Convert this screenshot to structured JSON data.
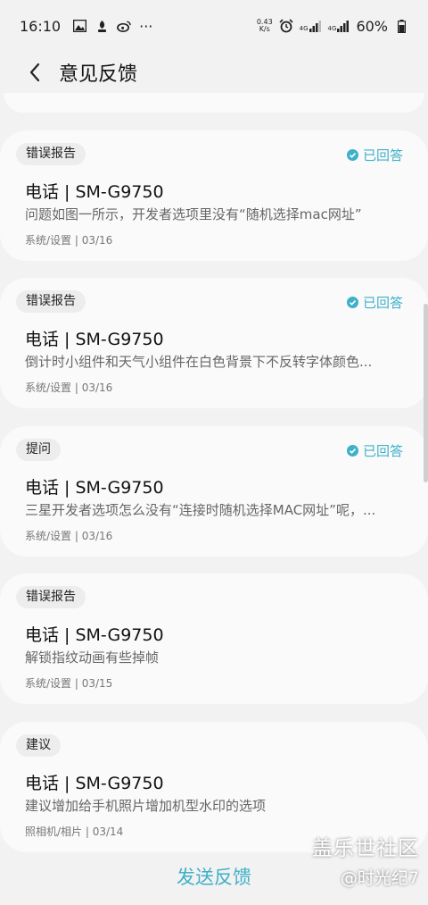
{
  "status_bar": {
    "time": "16:10",
    "more": "···",
    "net_speed_value": "0.43",
    "net_speed_unit": "K/s",
    "signal_label_1": "4G",
    "signal_label_2": "4G",
    "battery": "60%"
  },
  "header": {
    "title": "意见反馈"
  },
  "cards": [
    {
      "tag": "错误报告",
      "status": "已回答",
      "title": "电话 | SM-G9750",
      "desc": "问题如图一所示，开发者选项里没有“随机选择mac网址”",
      "meta": "系统/设置 | 03/16"
    },
    {
      "tag": "错误报告",
      "status": "已回答",
      "title": "电话 | SM-G9750",
      "desc": "倒计时小组件和天气小组件在白色背景下不反转字体颜色...",
      "meta": "系统/设置 | 03/16"
    },
    {
      "tag": "提问",
      "status": "已回答",
      "title": "电话 | SM-G9750",
      "desc": "三星开发者选项怎么没有“连接时随机选择MAC网址”呢，...",
      "meta": "系统/设置 | 03/16"
    },
    {
      "tag": "错误报告",
      "status": "",
      "title": "电话 | SM-G9750",
      "desc": "解锁指纹动画有些掉帧",
      "meta": "系统/设置 | 03/15"
    },
    {
      "tag": "建议",
      "status": "",
      "title": "电话 | SM-G9750",
      "desc": "建议增加给手机照片增加机型水印的选项",
      "meta": "照相机/相片 | 03/14"
    }
  ],
  "send_button": "发送反馈",
  "watermark": {
    "line1": "盖乐世社区",
    "line2": "@时光纪7"
  },
  "colors": {
    "accent": "#3fb0c9",
    "card_bg": "#fafafa",
    "page_bg": "#f2f2f2"
  }
}
